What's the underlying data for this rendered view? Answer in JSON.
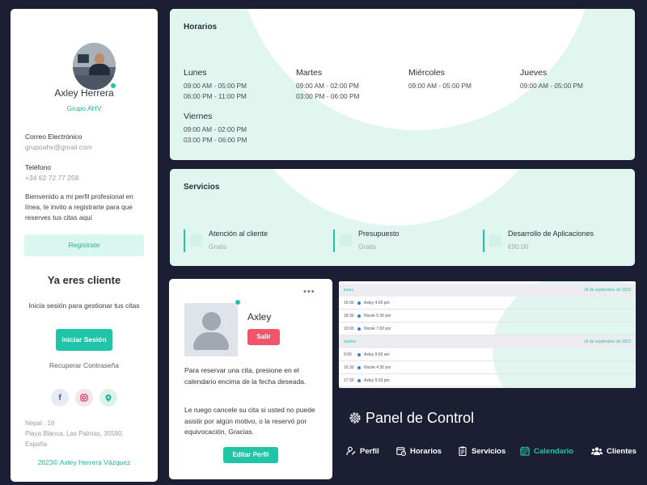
{
  "profile": {
    "name": "Axley Herrera",
    "company": "Grupo AHV",
    "email_label": "Correo Electrónico",
    "email": "grupoahv@gmail.com",
    "phone_label": "Teléfono",
    "phone": "+34 62 72 77 258",
    "bio": "Bienvenido a mi perfil profesional en línea, te invito a registrarte para que reserves tus citas aquí",
    "register_label": "Registrate",
    "client_title": "Ya eres cliente",
    "client_subtitle": "Inicia sesión para gestionar tus citas",
    "login_label": "Iniciar Sesión",
    "recover_label": "Recuperar Contraseña",
    "address": [
      "Nepal , 16",
      "Playa Blanca, Las Palmas, 35580,",
      "España"
    ],
    "copyright": "2023© Axley Herrera Vázquez"
  },
  "horarios": {
    "title": "Horarios",
    "days": [
      {
        "name": "Lunes",
        "slots": [
          "09:00 AM - 05:00 PM",
          "06:00 PM - 11:00 PM"
        ]
      },
      {
        "name": "Martes",
        "slots": [
          "09:00 AM - 02:00 PM",
          "03:00 PM - 06:00 PM"
        ]
      },
      {
        "name": "Miércoles",
        "slots": [
          "09:00 AM - 05:00 PM"
        ]
      },
      {
        "name": "Jueves",
        "slots": [
          "09:00 AM - 05:00 PM"
        ]
      },
      {
        "name": "Viernes",
        "slots": [
          "09:00 AM - 02:00 PM",
          "03:00 PM - 06:00 PM"
        ]
      }
    ]
  },
  "servicios": {
    "title": "Servicios",
    "items": [
      {
        "name": "Atención al cliente",
        "price": "Gratis"
      },
      {
        "name": "Presupuesto",
        "price": "Gratis"
      },
      {
        "name": "Desarrollo de Aplicaciones",
        "price": "€90.00"
      }
    ]
  },
  "booking": {
    "dots": "•••",
    "name": "Axley",
    "logout_label": "Salir",
    "text1": "Para reservar una cita, presione en el calendario encima de la fecha deseada.",
    "text2": "Le ruego cancele su cita si usted no puede asistir por algún motivo, o la reservó por equivocación, Gracias.",
    "edit_label": "Editar Perfil"
  },
  "calendar": {
    "days": [
      {
        "name": "lunes",
        "date": "18 de septiembre de 2023",
        "rows": [
          {
            "time": "16:00",
            "event": "Axley 4:00 pm"
          },
          {
            "time": "18:30",
            "event": "Nicole 6:30 pm"
          },
          {
            "time": "19:00",
            "event": "Nicole 7:00 pm"
          }
        ]
      },
      {
        "name": "martes",
        "date": "19 de septiembre de 2023",
        "rows": [
          {
            "time": "9:00",
            "event": "Axley 9:00 am"
          },
          {
            "time": "16:30",
            "event": "Nicole 4:30 pm"
          },
          {
            "time": "17:30",
            "event": "Axley 5:30 pm"
          }
        ]
      }
    ]
  },
  "panel": {
    "title": "Panel de Control",
    "nav": [
      {
        "label": "Perfil",
        "icon": "user-edit-icon"
      },
      {
        "label": "Horarios",
        "icon": "calendar-clock-icon"
      },
      {
        "label": "Servicios",
        "icon": "clipboard-icon"
      },
      {
        "label": "Calendario",
        "icon": "calendar-icon",
        "active": true
      },
      {
        "label": "Clientes",
        "icon": "users-icon"
      }
    ]
  },
  "colors": {
    "accent": "#1fc4a9",
    "danger": "#f2546a",
    "background": "#1c1f33",
    "mint": "#e1f6ef"
  }
}
